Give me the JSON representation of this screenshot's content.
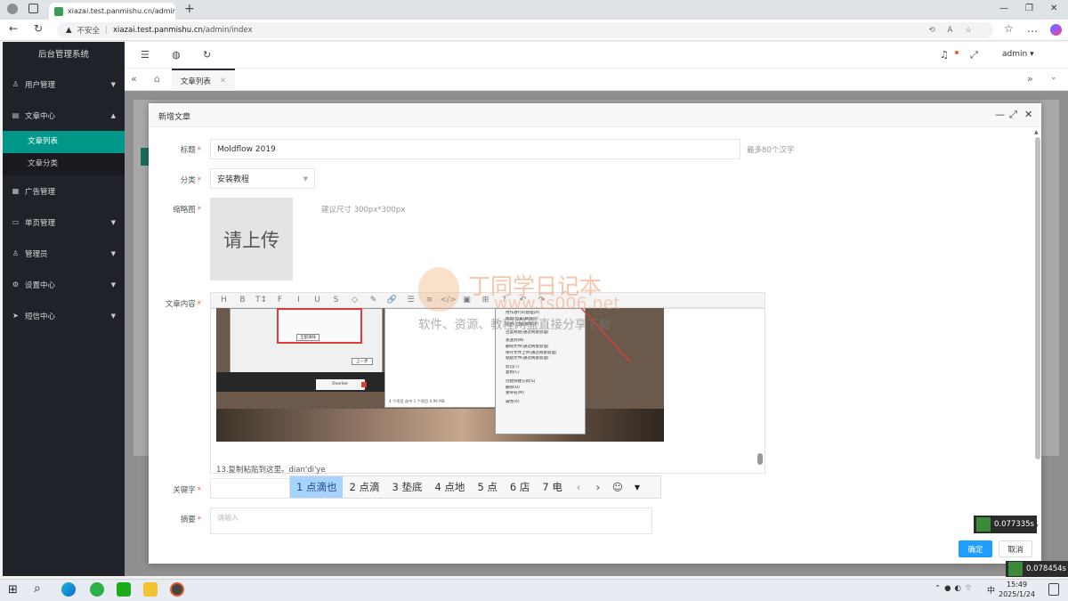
{
  "browser": {
    "tab_title": "xiazai.test.panmishu.cn/admin/in...",
    "url_warning": "不安全",
    "url_host": "xiazai.test.panmishu.cn",
    "url_path": "/admin/index"
  },
  "sidebar": {
    "title": "后台管理系统",
    "items": [
      {
        "label": "用户管理",
        "icon": "user-icon"
      },
      {
        "label": "文章中心",
        "icon": "doc-icon"
      },
      {
        "label": "广告管理",
        "icon": "ad-icon"
      },
      {
        "label": "单页管理",
        "icon": "page-icon"
      },
      {
        "label": "管理员",
        "icon": "admin-icon"
      },
      {
        "label": "设置中心",
        "icon": "gear-icon"
      },
      {
        "label": "短信中心",
        "icon": "send-icon"
      }
    ],
    "subitems": [
      "文章列表",
      "文章分类"
    ]
  },
  "header": {
    "user": "admin",
    "page_tab": "文章列表"
  },
  "modal": {
    "title": "新增文章",
    "title_label": "标题",
    "title_value": "Moldflow 2019",
    "title_hint": "最多80个汉字",
    "category_label": "分类",
    "category_value": "安装教程",
    "thumb_label": "缩略图",
    "thumb_upload": "请上传",
    "thumb_hint": "建议尺寸 300px*300px",
    "content_label": "文章内容",
    "content_text": "13.复制粘贴到这里。dian'di'ye",
    "keywords_label": "关键字",
    "summary_label": "摘要",
    "summary_placeholder": "请输入",
    "ok_label": "确定",
    "cancel_label": "取消"
  },
  "toolbar": [
    "H",
    "B",
    "T↕",
    "F",
    "I",
    "U",
    "S",
    "◇",
    "✎",
    "🔗",
    "☰",
    "≡",
    "</>",
    "▣",
    "⊞",
    "?",
    "↶",
    "↷"
  ],
  "embedded_context_menu": [
    "用作进行的管理(A)",
    "保留(位置)删除(P)",
    "还原(上级)版本(V)",
    "百度网盘(通过网盘管理)",
    "发送到(N)",
    "删除文件(通过网盘管理)",
    "保存文件上传(通过网盘管理)",
    "粘贴文件(通过网盘管理)",
    "剪切(T)",
    "复制(C)",
    "创建快捷方式(S)",
    "删除(D)",
    "重命名(M)",
    "属性(R)"
  ],
  "embedded_window": {
    "status": "4 个项目   选中 1 个项目 0.99 MB",
    "button": "全部清除",
    "nav": "上一步",
    "taskbar_item": "Overlee"
  },
  "ime": {
    "candidates": [
      "1 点滴也",
      "2 点滴",
      "3 垫底",
      "4 点地",
      "5 点",
      "6 店",
      "7 电"
    ]
  },
  "watermark": {
    "line1": "丁同学日记本",
    "line2": "www.ts006.net",
    "line3": "软件、资源、教程网盘直接分享下载"
  },
  "timers": {
    "modal": "0.077335s",
    "page": "0.078454s"
  },
  "taskbar": {
    "time": "15:49",
    "date": "2025/1/24",
    "lang": "中"
  }
}
